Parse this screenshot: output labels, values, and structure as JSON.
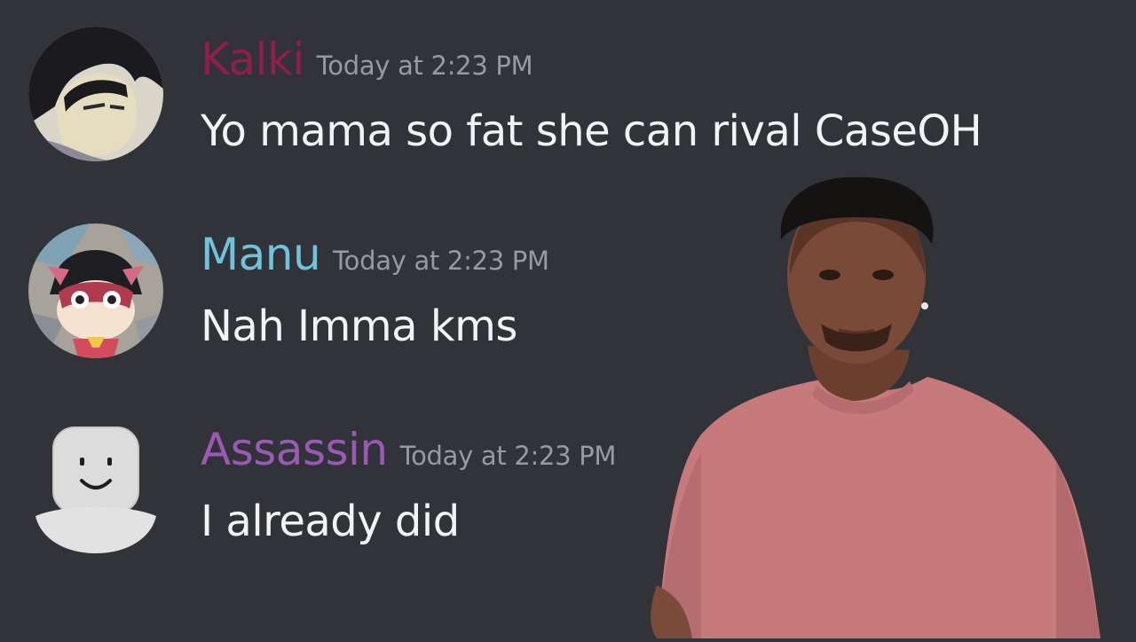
{
  "messages": [
    {
      "username": "Kalki",
      "username_color": "#8f1f48",
      "timestamp": "Today at 2:23 PM",
      "content": "Yo mama so fat she can rival CaseOH",
      "avatar_icon": "anime-dark-hair-avatar-icon"
    },
    {
      "username": "Manu",
      "username_color": "#6fc3df",
      "timestamp": "Today at 2:23 PM",
      "content": "Nah Imma kms",
      "avatar_icon": "masked-cartoon-avatar-icon"
    },
    {
      "username": "Assassin",
      "username_color": "#9b59b6",
      "timestamp": "Today at 2:23 PM",
      "content": "I already did",
      "avatar_icon": "roblox-default-avatar-icon"
    }
  ],
  "overlay": {
    "subject": "man-in-pink-tshirt-photo"
  },
  "colors": {
    "background": "#313338",
    "text": "#f2f3f5",
    "timestamp": "#949ba4"
  }
}
